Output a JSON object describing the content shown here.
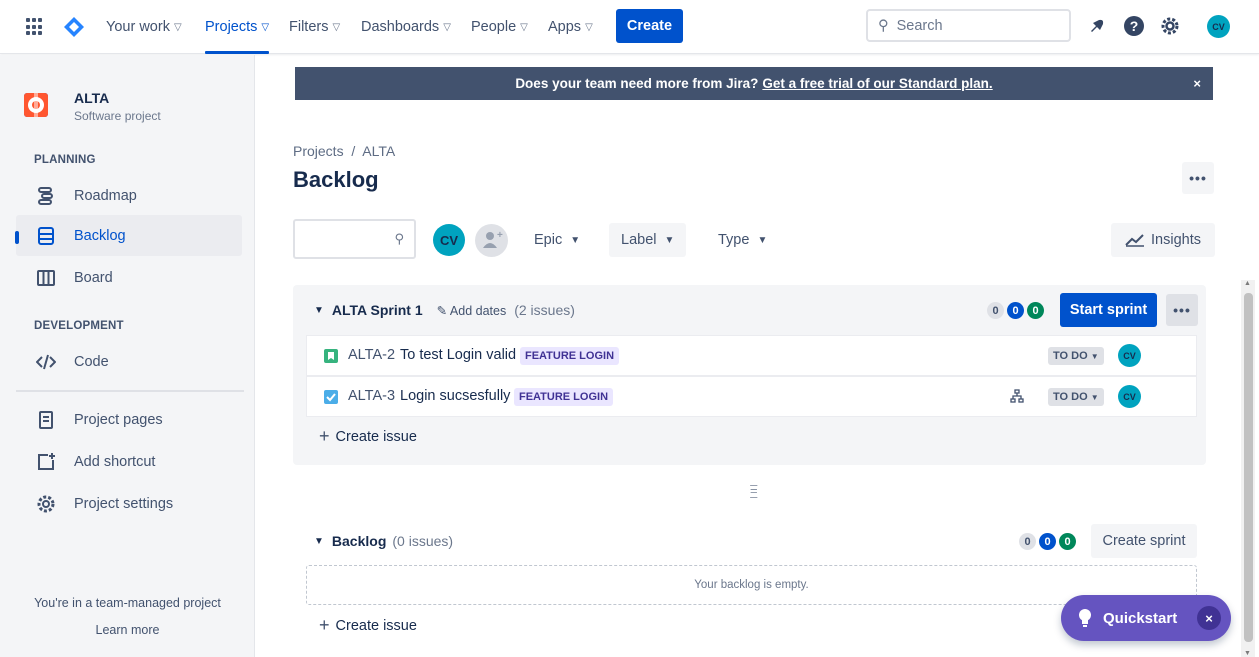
{
  "topnav": {
    "items": [
      {
        "label": "Your work"
      },
      {
        "label": "Projects"
      },
      {
        "label": "Filters"
      },
      {
        "label": "Dashboards"
      },
      {
        "label": "People"
      },
      {
        "label": "Apps"
      }
    ],
    "create_label": "Create",
    "search_placeholder": "Search",
    "user_initials": "CV"
  },
  "sidebar": {
    "project_name": "ALTA",
    "project_type": "Software project",
    "planning_heading": "PLANNING",
    "planning_items": [
      {
        "label": "Roadmap"
      },
      {
        "label": "Backlog"
      },
      {
        "label": "Board"
      }
    ],
    "development_heading": "DEVELOPMENT",
    "development_items": [
      {
        "label": "Code"
      }
    ],
    "extra_items": [
      {
        "label": "Project pages"
      },
      {
        "label": "Add shortcut"
      },
      {
        "label": "Project settings"
      }
    ],
    "team_note": "You're in a team-managed project",
    "learn_more": "Learn more"
  },
  "banner": {
    "text": "Does your team need more from Jira?",
    "link": "Get a free trial of our Standard plan.",
    "close": "×"
  },
  "breadcrumb": "Projects  /  ALTA",
  "title": "Backlog",
  "filters": {
    "avatar_initials": "CV",
    "epic": "Epic",
    "label": "Label",
    "type": "Type",
    "insights": "Insights"
  },
  "sprint": {
    "name": "ALTA Sprint 1",
    "add_dates": "Add dates",
    "issue_count": "(2 issues)",
    "counts": [
      "0",
      "0",
      "0"
    ],
    "start_label": "Start sprint",
    "issues": [
      {
        "key": "ALTA-2",
        "summary": "To test Login valid",
        "label": "FEATURE LOGIN",
        "status": "TO DO",
        "type": "story",
        "assignee": "CV"
      },
      {
        "key": "ALTA-3",
        "summary": "Login sucsesfully",
        "label": "FEATURE LOGIN",
        "status": "TO DO",
        "type": "task",
        "assignee": "CV"
      }
    ],
    "create_issue": "Create issue"
  },
  "backlog": {
    "name": "Backlog",
    "issue_count": "(0 issues)",
    "counts": [
      "0",
      "0",
      "0"
    ],
    "create_sprint": "Create sprint",
    "empty_text": "Your backlog is empty.",
    "create_issue": "Create issue"
  },
  "quickstart": {
    "label": "Quickstart",
    "close": "×"
  },
  "colors": {
    "brand": "#0052cc",
    "quickstart": "#6554c0",
    "lozenge_bg": "#eae6ff",
    "avatar": "#00a3bf"
  }
}
